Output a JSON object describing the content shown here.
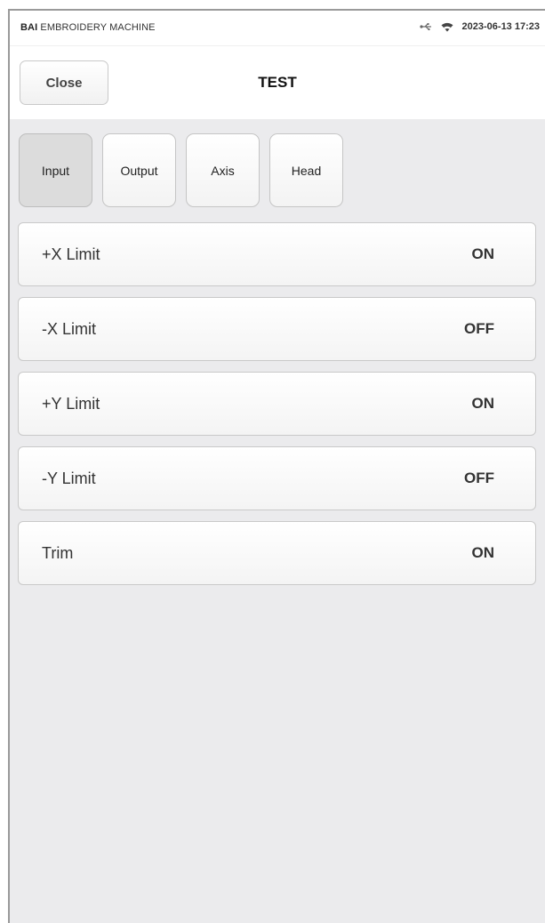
{
  "status_bar": {
    "brand_bold": "BAI",
    "brand_rest": " EMBROIDERY MACHINE",
    "datetime": "2023-06-13 17:23",
    "icons": [
      "usb-icon",
      "wifi-icon"
    ]
  },
  "header": {
    "close_label": "Close",
    "title": "TEST"
  },
  "tabs": [
    {
      "label": "Input",
      "active": true
    },
    {
      "label": "Output",
      "active": false
    },
    {
      "label": "Axis",
      "active": false
    },
    {
      "label": "Head",
      "active": false
    }
  ],
  "rows": [
    {
      "label": "+X Limit",
      "value": "ON"
    },
    {
      "label": "-X Limit",
      "value": "OFF"
    },
    {
      "label": "+Y Limit",
      "value": "ON"
    },
    {
      "label": "-Y Limit",
      "value": "OFF"
    },
    {
      "label": "Trim",
      "value": "ON"
    }
  ],
  "colors": {
    "background": "#ebebed",
    "active_tab": "#dcdcdc",
    "header": "#ffffff"
  }
}
